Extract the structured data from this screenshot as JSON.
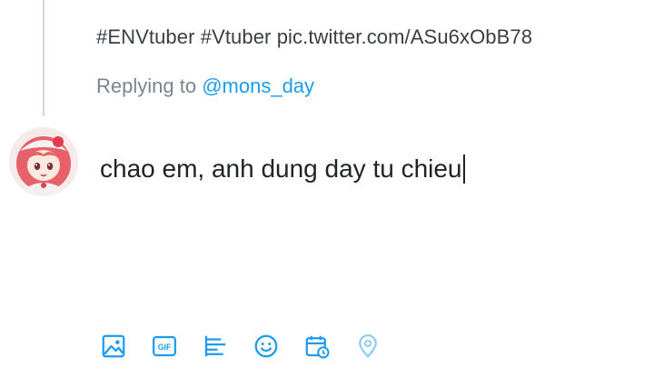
{
  "quoted_tweet": {
    "text": "#ENVtuber #Vtuber pic.twitter.com/ASu6xObB78"
  },
  "reply_context": {
    "prefix": "Replying to",
    "handle": "@mons_day"
  },
  "composer": {
    "value": "chao em, anh dung day tu chieu"
  },
  "toolbar": {
    "icons": [
      "image-icon",
      "gif-icon",
      "poll-icon",
      "emoji-icon",
      "schedule-icon",
      "location-icon"
    ],
    "accent_color": "#1d9bf0"
  }
}
